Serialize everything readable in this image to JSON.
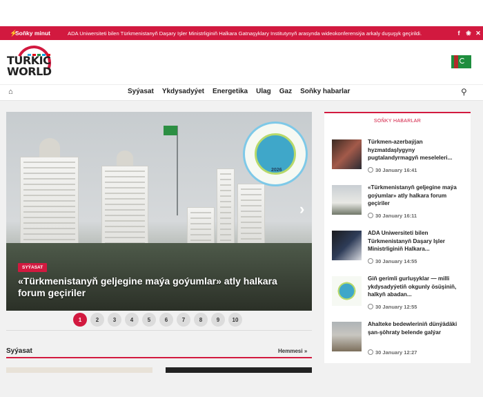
{
  "ticker": {
    "label": "Soňky minut",
    "text": "ADA Uniwersiteti bilen Türkmenistanyň Daşary Işler Ministrliginiň Halkara Gatnaşyklary Institutynyň arasynda wideokonferensiýa arkaly duşuşyk geçirildi.",
    "social": [
      "facebook-icon",
      "twitter-icon",
      "x-icon"
    ]
  },
  "logo": {
    "line1": "TURKIC",
    "line2": "WORLD"
  },
  "nav": {
    "items": [
      "Syýasat",
      "Ykdysadyýet",
      "Energetika",
      "Ulag",
      "Gaz",
      "Soňky habarlar"
    ]
  },
  "hero": {
    "category": "SYÝASAT",
    "title": "«Türkmenistanyň geljegine maýa goýumlar» atly halkara forum geçiriler",
    "seal_year": "2026"
  },
  "pager": [
    "1",
    "2",
    "3",
    "4",
    "5",
    "6",
    "7",
    "8",
    "9",
    "10"
  ],
  "section": {
    "title": "Syýasat",
    "more": "Hemmesi"
  },
  "sidebar": {
    "heading": "SOŇKY HABARLAR",
    "items": [
      {
        "title": "Türkmen-azerbaýjan hyzmatdaşlygyny pugtalandyrmagyň meseleleri...",
        "date": "30 January 16:41"
      },
      {
        "title": "«Türkmenistanyň geljegine maýa goýumlar» atly halkara forum geçiriler",
        "date": "30 January 16:11"
      },
      {
        "title": "ADA Uniwersiteti bilen Türkmenistanyň Daşary Işler Ministrliginiň Halkara...",
        "date": "30 January 14:55"
      },
      {
        "title": "Giň gerimli gurluşyklar — milli ykdysadyýetiň okgunly ösüşiniň, halkyň abadan...",
        "date": "30 January 12:55"
      },
      {
        "title": "Ahalteke bedewleriniň dünýädäki şan-şöhraty belende galýar",
        "date": "30 January 12:27"
      }
    ]
  }
}
